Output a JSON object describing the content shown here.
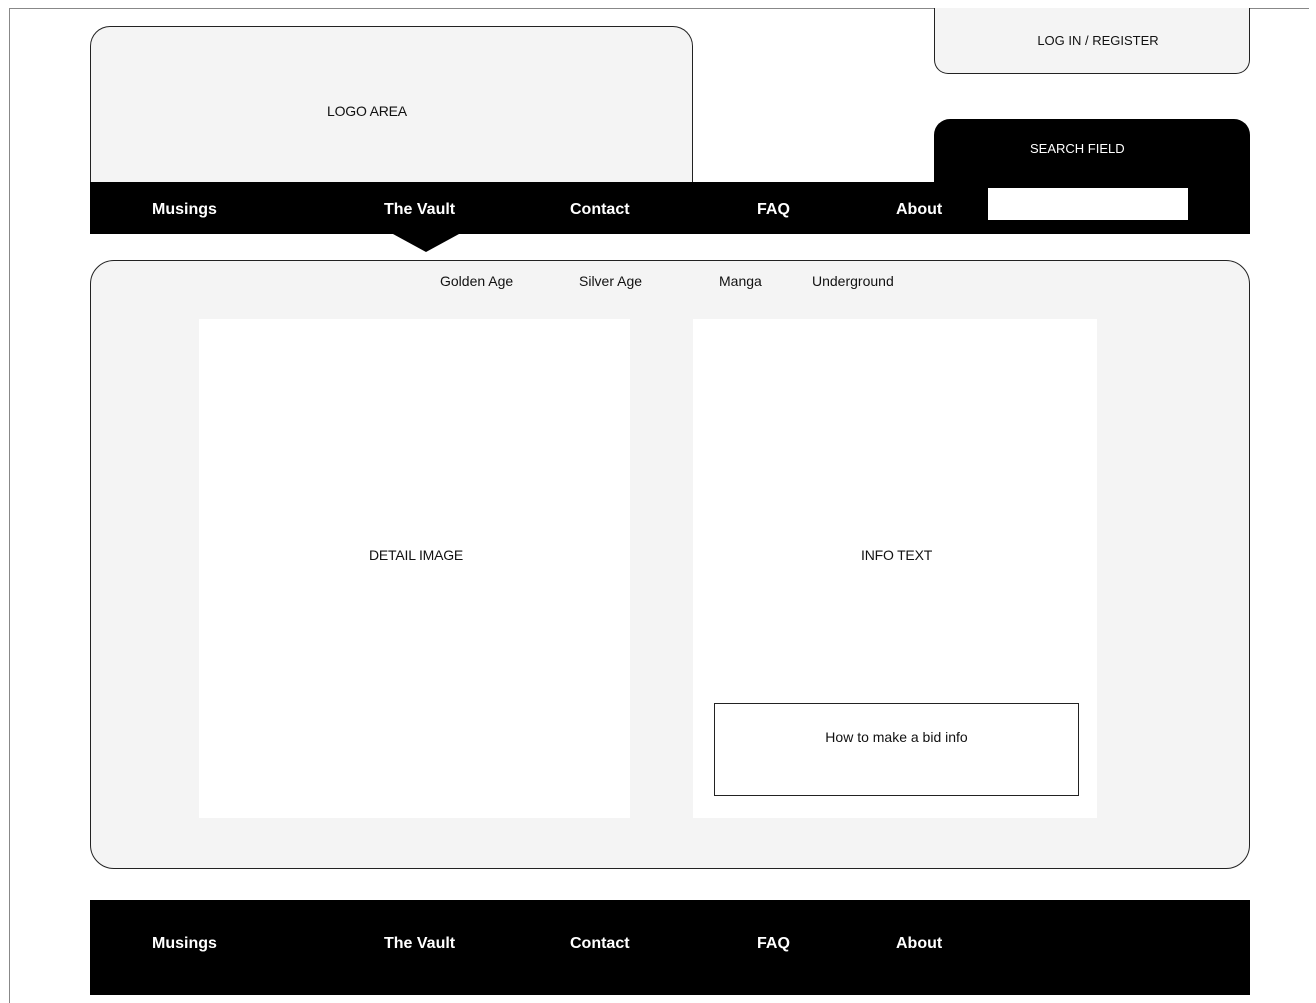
{
  "header": {
    "logo_text": "LOGO AREA",
    "login_label": "LOG IN / REGISTER",
    "search_label": "SEARCH FIELD",
    "search_value": ""
  },
  "nav": {
    "items": [
      "Musings",
      "The Vault",
      "Contact",
      "FAQ",
      "About"
    ],
    "active": "The Vault"
  },
  "subnav": {
    "items": [
      "Golden Age",
      "Silver Age",
      "Manga",
      "Underground"
    ]
  },
  "content": {
    "detail_image_label": "DETAIL IMAGE",
    "info_text_label": "INFO TEXT",
    "bid_info_label": "How to make a bid info"
  },
  "footer": {
    "items": [
      "Musings",
      "The Vault",
      "Contact",
      "FAQ",
      "About"
    ]
  }
}
